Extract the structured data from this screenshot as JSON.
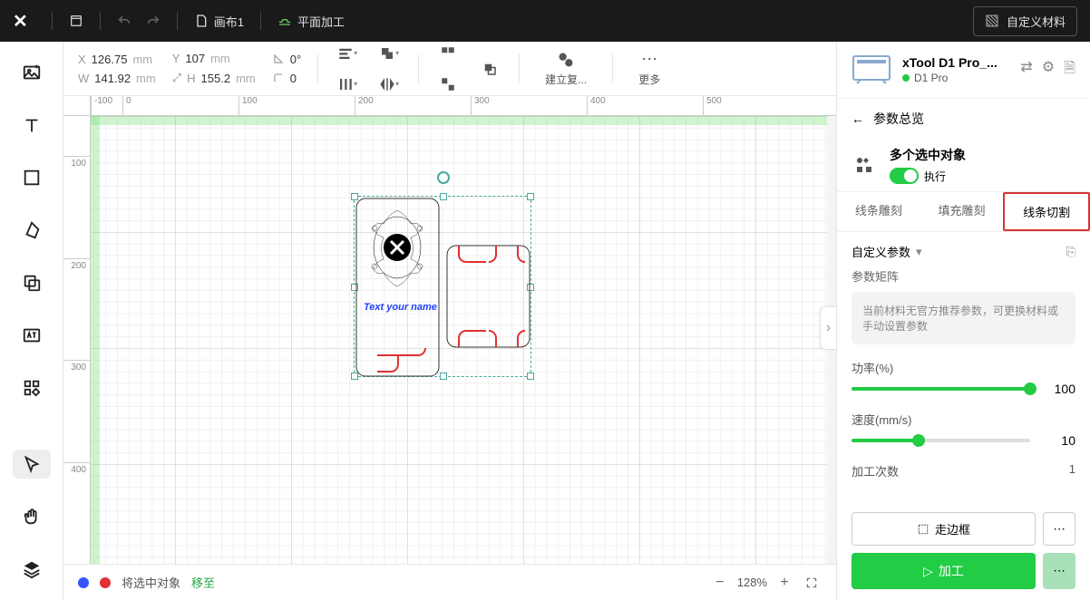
{
  "topbar": {
    "canvas_label": "画布1",
    "mode_label": "平面加工",
    "custom_material": "自定义材料"
  },
  "props": {
    "x_label": "X",
    "x_val": "126.75",
    "x_unit": "mm",
    "y_label": "Y",
    "y_val": "107",
    "y_unit": "mm",
    "w_label": "W",
    "w_val": "141.92",
    "w_unit": "mm",
    "h_label": "H",
    "h_val": "155.2",
    "h_unit": "mm",
    "angle_val": "0°",
    "radius_val": "0",
    "dup_label": "建立复...",
    "more_label": "更多"
  },
  "canvas": {
    "ruler_h": [
      "-100",
      "0",
      "100",
      "200",
      "300",
      "400",
      "500"
    ],
    "ruler_v": [
      "100",
      "200",
      "300",
      "400"
    ],
    "text_content": "Text your name"
  },
  "status": {
    "sel_text": "将选中对象",
    "move_text": "移至",
    "zoom": "128%"
  },
  "device": {
    "name": "xTool D1 Pro_...",
    "status": "D1 Pro"
  },
  "params": {
    "overview": "参数总览",
    "sel_title": "多个选中对象",
    "exec_label": "执行",
    "tabs": [
      "线条雕刻",
      "填充雕刻",
      "线条切割"
    ],
    "custom_params": "自定义参数",
    "matrix_label": "参数矩阵",
    "matrix_text": "当前材料无官方推荐参数，可更换材料或手动设置参数",
    "power_label": "功率(%)",
    "power_val": "100",
    "speed_label": "速度(mm/s)",
    "speed_val": "10",
    "count_label": "加工次数",
    "count_val": "1",
    "frame_btn": "走边框",
    "process_btn": "加工"
  }
}
